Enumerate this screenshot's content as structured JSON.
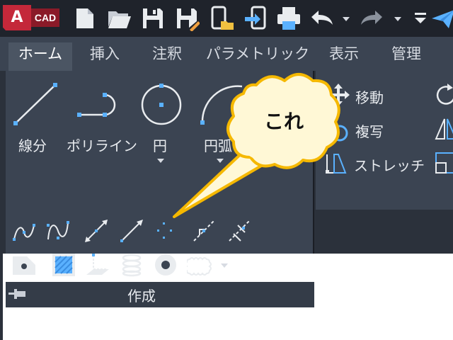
{
  "app": {
    "logo_letter": "A",
    "logo_text": "CAD"
  },
  "quick_access": [
    {
      "icon": "new-file-icon"
    },
    {
      "icon": "open-folder-icon"
    },
    {
      "icon": "save-icon"
    },
    {
      "icon": "save-as-icon"
    },
    {
      "icon": "open-from-mobile-icon"
    },
    {
      "icon": "save-to-mobile-icon"
    },
    {
      "icon": "print-icon"
    },
    {
      "icon": "undo-icon"
    },
    {
      "icon": "redo-icon"
    },
    {
      "icon": "customize-dropdown-icon"
    },
    {
      "icon": "share-icon"
    }
  ],
  "tabs": [
    {
      "label": "ホーム",
      "active": true
    },
    {
      "label": "挿入"
    },
    {
      "label": "注釈"
    },
    {
      "label": "パラメトリック"
    },
    {
      "label": "表示"
    },
    {
      "label": "管理"
    }
  ],
  "draw_panel": {
    "title": "作成",
    "big_tools": [
      {
        "label": "線分",
        "icon": "line-icon"
      },
      {
        "label": "ポリライン",
        "icon": "polyline-icon"
      },
      {
        "label": "円",
        "icon": "circle-icon"
      },
      {
        "label": "円弧",
        "icon": "arc-icon"
      }
    ],
    "row1_tools": [
      "spline-fit-icon",
      "spline-cv-icon",
      "construction-line-icon",
      "ray-icon",
      "multiple-points-icon",
      "divide-icon",
      "measure-icon"
    ],
    "row2_tools": [
      "region-icon",
      "hatch-icon",
      "boundary-icon",
      "helix-icon",
      "donut-icon",
      "revision-cloud-icon"
    ]
  },
  "modify_panel": {
    "tools": [
      {
        "label": "移動",
        "icon": "move-icon"
      },
      {
        "label": "複写",
        "icon": "copy-icon"
      },
      {
        "label": "ストレッチ",
        "icon": "stretch-icon"
      }
    ]
  },
  "callout": {
    "text": "これ"
  },
  "colors": {
    "accent_blue": "#5ab1ff",
    "callout_fill": "#fff8d6",
    "callout_border": "#f5b800"
  }
}
